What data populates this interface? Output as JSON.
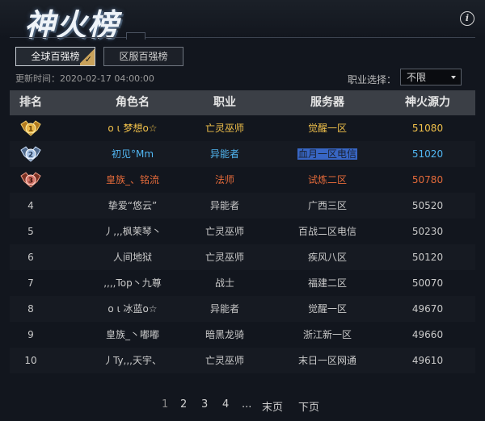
{
  "header": {
    "title": "神火榜"
  },
  "tabs": [
    {
      "label": "全球百强榜",
      "active": true
    },
    {
      "label": "区服百强榜",
      "active": false
    }
  ],
  "update_time": "更新时间：2020-02-17 04:00:00",
  "job_filter": {
    "label": "职业选择：",
    "value": "不限"
  },
  "table": {
    "headers": [
      "排名",
      "角色名",
      "职业",
      "服务器",
      "神火源力"
    ],
    "rows": [
      {
        "rank": "1",
        "medal": "gold-medal",
        "name": "o ι 梦想o☆",
        "job": "亡灵巫师",
        "server": "觉醒一区",
        "power": "51080"
      },
      {
        "rank": "2",
        "medal": "silver-medal",
        "name": "初见°Mm",
        "job": "异能者",
        "server": "血月一区电信",
        "power": "51020"
      },
      {
        "rank": "3",
        "medal": "bronze-medal",
        "name": "皇族_、铭流",
        "job": "法师",
        "server": "试炼二区",
        "power": "50780"
      },
      {
        "rank": "4",
        "medal": "",
        "name": "挚爱“悠云”",
        "job": "异能者",
        "server": "广西三区",
        "power": "50520"
      },
      {
        "rank": "5",
        "medal": "",
        "name": "丿,,,枫茉琴丶",
        "job": "亡灵巫师",
        "server": "百战二区电信",
        "power": "50230"
      },
      {
        "rank": "6",
        "medal": "",
        "name": "人间地狱",
        "job": "亡灵巫师",
        "server": "疾风八区",
        "power": "50120"
      },
      {
        "rank": "7",
        "medal": "",
        "name": ",,,,Top丶九尊",
        "job": "战士",
        "server": "福建二区",
        "power": "50070"
      },
      {
        "rank": "8",
        "medal": "",
        "name": "o ι 冰蓝o☆",
        "job": "异能者",
        "server": "觉醒一区",
        "power": "49670"
      },
      {
        "rank": "9",
        "medal": "",
        "name": "皇族_丶嘟嘟",
        "job": "暗黑龙骑",
        "server": "浙江新一区",
        "power": "49660"
      },
      {
        "rank": "10",
        "medal": "",
        "name": "丿Ty,,,天宇、",
        "job": "亡灵巫师",
        "server": "末日一区网通",
        "power": "49610"
      }
    ]
  },
  "pagination": {
    "pages": [
      "1",
      "2",
      "3",
      "4"
    ],
    "ellipsis": "...",
    "last": "末页",
    "next": "下页",
    "current": "1"
  },
  "colors": {
    "gold": "#f0c04a",
    "silver": "#51b6f2",
    "bronze": "#e46a3a",
    "header_bar": "#3b3f46"
  }
}
